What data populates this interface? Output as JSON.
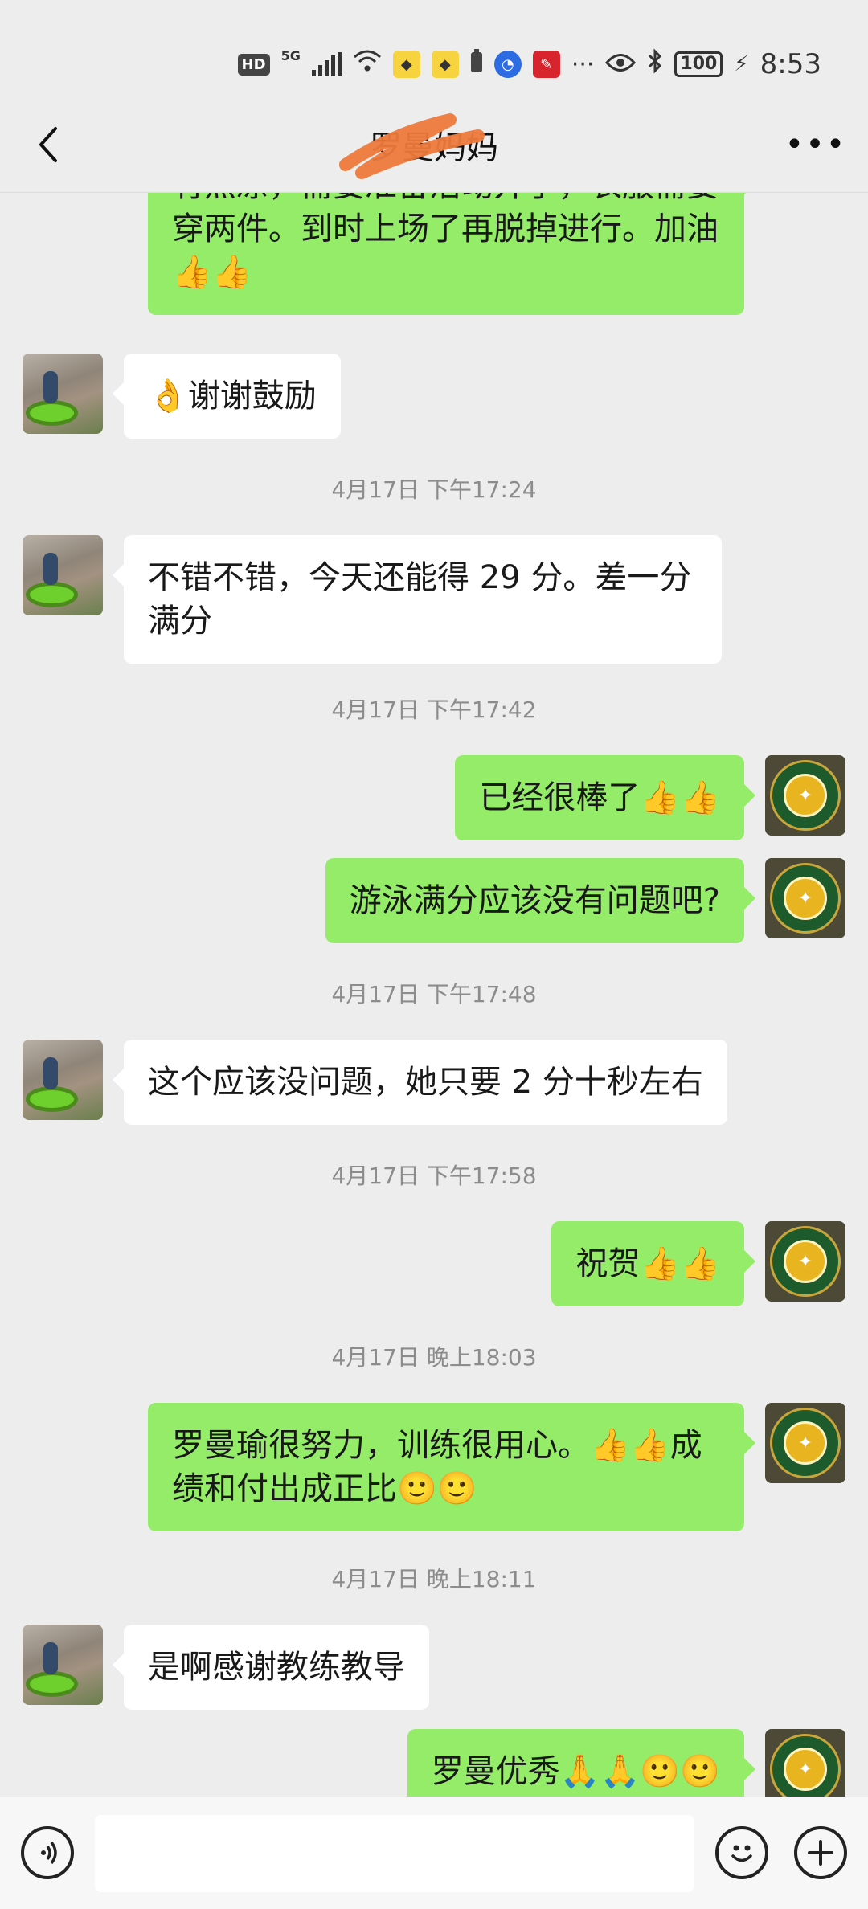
{
  "status_bar": {
    "hd": "HD",
    "network": "5G",
    "battery": "100",
    "time": "8:53",
    "icons": [
      "signal-icon",
      "wifi-icon",
      "meituan-app-icon",
      "meituan-app-icon",
      "battery-saver-icon",
      "baidu-app-icon",
      "app-icon",
      "more-dots-icon",
      "eye-icon",
      "bluetooth-icon",
      "battery-icon",
      "charging-icon"
    ]
  },
  "header": {
    "title": "罗曼妈妈",
    "back_icon": "chevron-left-icon",
    "more_icon": "more-dots-icon"
  },
  "messages": [
    {
      "type": "text",
      "side": "out",
      "text": "有点凉，需要准备活动开了，衣服需要穿两件。到时上场了再脱掉进行。加油👍👍"
    },
    {
      "type": "text",
      "side": "in",
      "text": "👌谢谢鼓励"
    },
    {
      "type": "time",
      "text": "4月17日 下午17:24"
    },
    {
      "type": "text",
      "side": "in",
      "text": "不错不错，今天还能得 29 分。差一分满分"
    },
    {
      "type": "time",
      "text": "4月17日 下午17:42"
    },
    {
      "type": "text",
      "side": "out",
      "text": "已经很棒了👍👍"
    },
    {
      "type": "text",
      "side": "out",
      "text": "游泳满分应该没有问题吧?"
    },
    {
      "type": "time",
      "text": "4月17日 下午17:48"
    },
    {
      "type": "text",
      "side": "in",
      "text": "这个应该没问题，她只要 2 分十秒左右"
    },
    {
      "type": "time",
      "text": "4月17日 下午17:58"
    },
    {
      "type": "text",
      "side": "out",
      "text": "祝贺👍👍"
    },
    {
      "type": "time",
      "text": "4月17日 晚上18:03"
    },
    {
      "type": "text",
      "side": "out",
      "text": "罗曼瑜很努力，训练很用心。👍👍成绩和付出成正比🙂🙂"
    },
    {
      "type": "time",
      "text": "4月17日 晚上18:11"
    },
    {
      "type": "text",
      "side": "in",
      "text": "是啊感谢教练教导"
    },
    {
      "type": "text",
      "side": "out",
      "text": "罗曼优秀🙏🙏🙂🙂"
    }
  ],
  "input_bar": {
    "voice_icon": "voice-icon",
    "input_value": "",
    "emoji_icon": "emoji-icon",
    "plus_icon": "plus-icon"
  }
}
